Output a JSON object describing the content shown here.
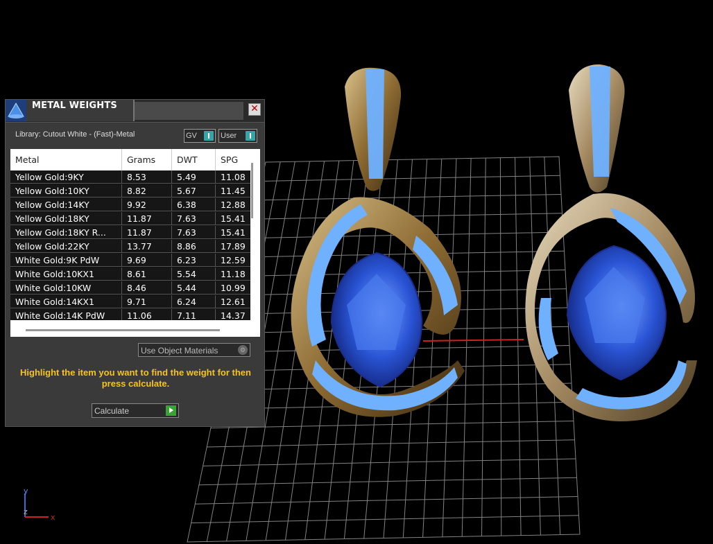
{
  "panel": {
    "title": "METAL WEIGHTS",
    "close_icon": "close-icon",
    "library_label": "Library: Cutout White - (Fast)-Metal",
    "gv_toggle_label": "GV",
    "user_toggle_label": "User",
    "use_materials_label": "Use Object Materials",
    "hint": "Highlight the item you want to find the weight for then press calculate.",
    "calculate_label": "Calculate"
  },
  "table": {
    "headers": [
      "Metal",
      "Grams",
      "DWT",
      "SPG"
    ],
    "rows": [
      {
        "metal": "Yellow Gold:9KY",
        "grams": "8.53",
        "dwt": "5.49",
        "spg": "11.08"
      },
      {
        "metal": "Yellow Gold:10KY",
        "grams": "8.82",
        "dwt": "5.67",
        "spg": "11.45"
      },
      {
        "metal": "Yellow Gold:14KY",
        "grams": "9.92",
        "dwt": "6.38",
        "spg": "12.88"
      },
      {
        "metal": "Yellow Gold:18KY",
        "grams": "11.87",
        "dwt": "7.63",
        "spg": "15.41"
      },
      {
        "metal": "Yellow Gold:18KY R...",
        "grams": "11.87",
        "dwt": "7.63",
        "spg": "15.41"
      },
      {
        "metal": "Yellow Gold:22KY",
        "grams": "13.77",
        "dwt": "8.86",
        "spg": "17.89"
      },
      {
        "metal": "White Gold:9K PdW",
        "grams": "9.69",
        "dwt": "6.23",
        "spg": "12.59"
      },
      {
        "metal": "White Gold:10KX1",
        "grams": "8.61",
        "dwt": "5.54",
        "spg": "11.18"
      },
      {
        "metal": "White Gold:10KW",
        "grams": "8.46",
        "dwt": "5.44",
        "spg": "10.99"
      },
      {
        "metal": "White Gold:14KX1",
        "grams": "9.71",
        "dwt": "6.24",
        "spg": "12.61"
      },
      {
        "metal": "White Gold:14K PdW",
        "grams": "11.06",
        "dwt": "7.11",
        "spg": "14.37"
      }
    ]
  },
  "axis": {
    "x": "x",
    "y": "y",
    "z": "z"
  },
  "colors": {
    "hint": "#f5c518",
    "toggle": "#39a3a8",
    "calculate": "#3aa336",
    "gem": "#2a55d6"
  }
}
